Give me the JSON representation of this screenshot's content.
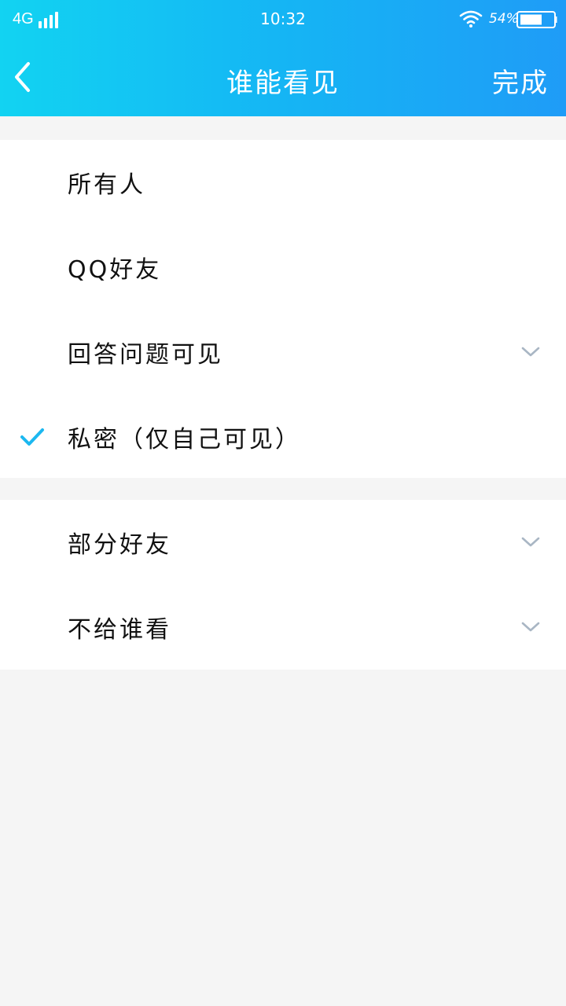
{
  "status_bar": {
    "network": "4G",
    "time": "10:32",
    "battery": "54%"
  },
  "header": {
    "title": "谁能看见",
    "done_label": "完成"
  },
  "groups": [
    {
      "options": [
        {
          "label": "所有人",
          "selected": false,
          "expandable": false
        },
        {
          "label": "QQ好友",
          "selected": false,
          "expandable": false
        },
        {
          "label": "回答问题可见",
          "selected": false,
          "expandable": true
        },
        {
          "label": "私密（仅自己可见）",
          "selected": true,
          "expandable": false
        }
      ]
    },
    {
      "options": [
        {
          "label": "部分好友",
          "selected": false,
          "expandable": true
        },
        {
          "label": "不给谁看",
          "selected": false,
          "expandable": true
        }
      ]
    }
  ],
  "icons": {
    "back": "chevron-left-icon",
    "check": "check-icon",
    "expand": "chevron-down-icon",
    "wifi": "wifi-icon",
    "battery": "battery-icon",
    "signal": "signal-icon"
  },
  "colors": {
    "header_gradient_start": "#12d3f2",
    "header_gradient_end": "#1f9cf7",
    "check": "#1cb8f0",
    "chevron": "#a9b6c4",
    "background": "#f5f5f5"
  }
}
